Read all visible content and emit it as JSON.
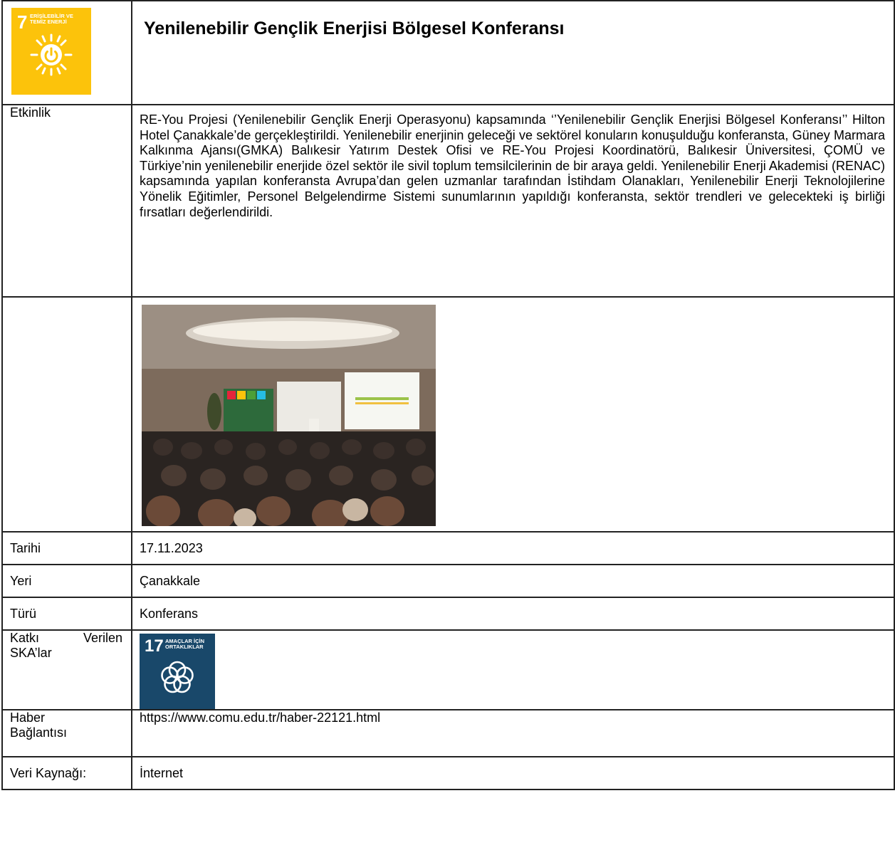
{
  "header": {
    "title": "Yenilenebilir Gençlik Enerjisi Bölgesel Konferansı",
    "sdg_badge": {
      "number": "7",
      "line1": "ERİŞİLEBİLİR VE",
      "line2": "TEMİZ ENERJİ",
      "color": "#FCC30B",
      "icon": "sun-power-icon"
    }
  },
  "etkinlik": {
    "label": "Etkinlik",
    "text": "RE-You Projesi (Yenilenebilir Gençlik Enerji Operasyonu) kapsamında ‘’Yenilenebilir Gençlik Enerjisi Bölgesel Konferansı’’  Hilton Hotel Çanakkale’de gerçekleştirildi. Yenilenebilir enerjinin geleceği ve sektörel konuların konuşulduğu konferansta, Güney Marmara Kalkınma Ajansı(GMKA) Balıkesir Yatırım Destek Ofisi ve RE-You Projesi Koordinatörü, Balıkesir Üniversitesi, ÇOMÜ ve Türkiye’nin yenilenebilir enerjide özel sektör ile sivil toplum temsilcilerinin de bir araya geldi. Yenilenebilir Enerji Akademisi (RENAC) kapsamında yapılan konferansta Avrupa’dan gelen uzmanlar tarafından İstihdam Olanakları, Yenilenebilir Enerji Teknolojilerine Yönelik Eğitimler, Personel Belgelendirme Sistemi sunumlarının yapıldığı konferansta,  sektör trendleri  ve gelecekteki iş birliği fırsatları değerlendirildi."
  },
  "photo": {
    "caption": ""
  },
  "tarihi": {
    "label": "Tarihi",
    "value": "17.11.2023"
  },
  "yeri": {
    "label": "Yeri",
    "value": "Çanakkale"
  },
  "turu": {
    "label": "Türü",
    "value": "Konferans"
  },
  "ska": {
    "label_line1": "Katkı Verilen",
    "label_line2": "SKA’lar",
    "badge": {
      "number": "17",
      "line1": "AMAÇLAR İÇİN",
      "line2": "ORTAKLIKLAR",
      "color": "#19486A",
      "icon": "flower-rings-icon"
    }
  },
  "haber": {
    "label_line1": "Haber",
    "label_line2": "Bağlantısı",
    "value": "https://www.comu.edu.tr/haber-22121.html"
  },
  "kaynak": {
    "label": "Veri Kaynağı:",
    "value": "İnternet"
  }
}
